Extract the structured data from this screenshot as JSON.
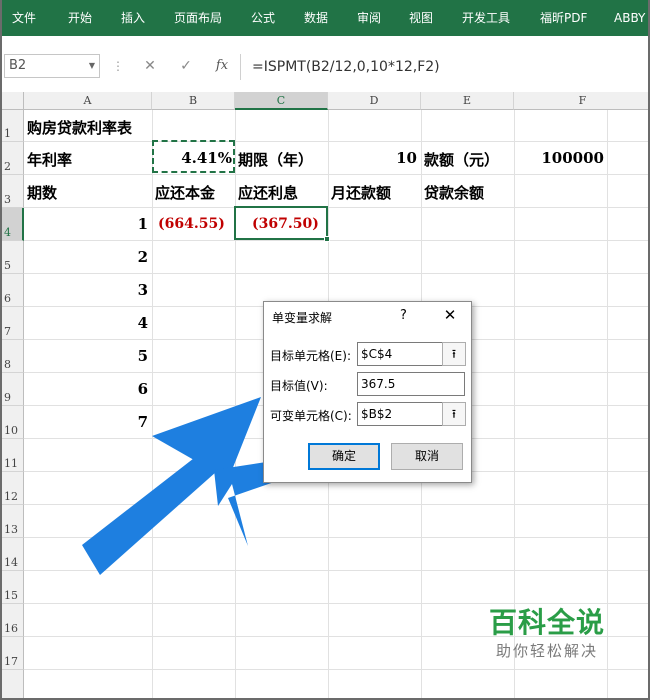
{
  "ribbon": {
    "tabs": [
      "文件",
      "开始",
      "插入",
      "页面布局",
      "公式",
      "数据",
      "审阅",
      "视图",
      "开发工具",
      "福昕PDF",
      "ABBY"
    ],
    "color": "#217346"
  },
  "formula_bar": {
    "name_box": "B2",
    "cancel_icon": "close-icon",
    "enter_icon": "check-icon",
    "fx_label": "fx",
    "formula": "=ISPMT(B2/12,0,10*12,F2)"
  },
  "columns": [
    "A",
    "B",
    "C",
    "D",
    "E",
    "F"
  ],
  "rows": [
    "1",
    "2",
    "3",
    "4",
    "5",
    "6",
    "7",
    "8",
    "9",
    "10",
    "11",
    "12",
    "13",
    "14",
    "15",
    "16",
    "17"
  ],
  "cells": {
    "A1": "购房贷款利率表",
    "A2": "年利率",
    "B2": "4.41%",
    "C2": "期限（年）",
    "D2": "10",
    "E2": "款额（元）",
    "F2": "100000",
    "A3": "期数",
    "B3": "应还本金",
    "C3": "应还利息",
    "D3": "月还款额",
    "E3": "贷款余额",
    "A4": "1",
    "B4": "(664.55)",
    "C4": "(367.50)",
    "A5": "2",
    "A6": "3",
    "A7": "4",
    "A8": "5",
    "A9": "6",
    "A10": "7"
  },
  "dialog": {
    "title": "单变量求解",
    "help": "?",
    "close": "✕",
    "target_cell_label": "目标单元格(E):",
    "target_cell_value": "$C$4",
    "target_value_label": "目标值(V):",
    "target_value": "367.5",
    "changing_cell_label": "可变单元格(C):",
    "changing_cell_value": "$B$2",
    "ok_label": "确定",
    "cancel_label": "取消"
  },
  "watermark": {
    "main": "百科全说",
    "sub": "助你轻松解决"
  },
  "colors": {
    "negative": "#c00000",
    "arrow": "#1e7fe0",
    "watermark": "#2a9d47"
  }
}
